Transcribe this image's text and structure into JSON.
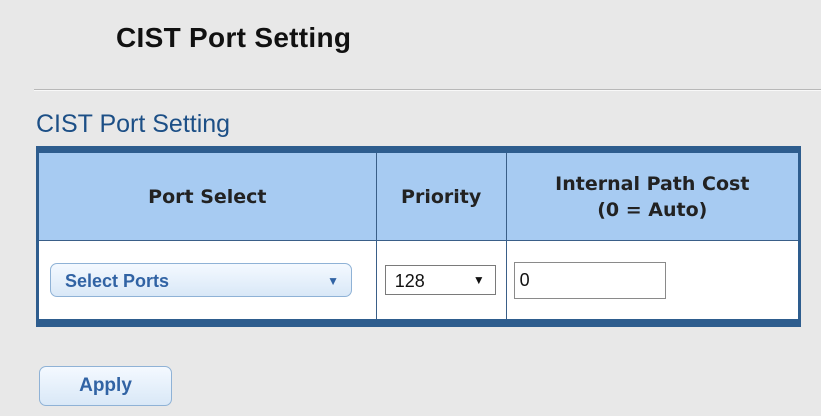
{
  "page": {
    "title": "CIST Port Setting"
  },
  "section": {
    "title": "CIST Port Setting"
  },
  "table": {
    "headers": {
      "port_select": "Port Select",
      "priority": "Priority",
      "internal_path_cost_line1": "Internal Path Cost",
      "internal_path_cost_line2": "(0 = Auto)"
    },
    "row": {
      "port_select_label": "Select Ports",
      "priority_value": "128",
      "internal_path_cost_value": "0"
    }
  },
  "actions": {
    "apply_label": "Apply"
  },
  "icons": {
    "port_select_caret": "caret-down-icon",
    "priority_caret": "caret-down-icon"
  },
  "colors": {
    "section_title": "#1c4f86",
    "table_border": "#2e5d8e",
    "table_header_bg": "#a7cbf2",
    "button_text": "#3163a4"
  }
}
